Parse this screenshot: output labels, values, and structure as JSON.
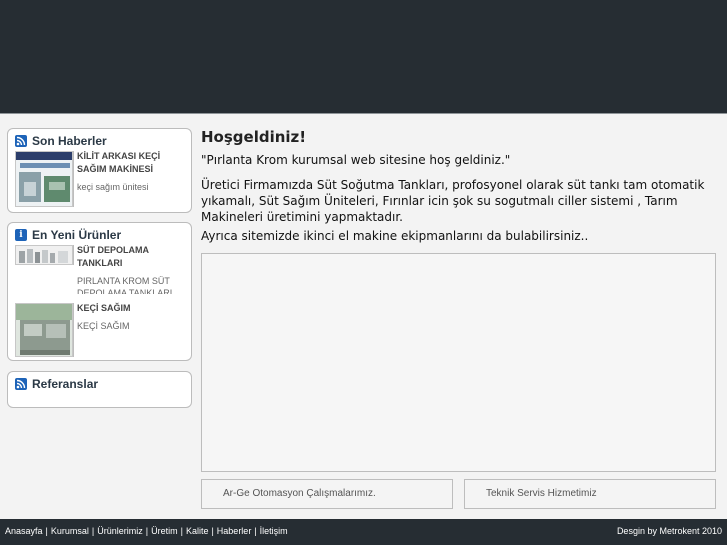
{
  "sidebar": {
    "news": {
      "title": "Son Haberler",
      "icon": "rss-icon",
      "items": [
        {
          "title": "KİLİT ARKASI KEÇİ SAĞIM MAKİNESİ",
          "subtitle": "keçi sağım ünitesi"
        }
      ]
    },
    "products": {
      "title": "En Yeni Ürünler",
      "icon": "info-icon",
      "items": [
        {
          "title": "SÜT DEPOLAMA TANKLARI",
          "subtitle": "PIRLANTA KROM SÜT DEPOLAMA TANKLARI"
        },
        {
          "title": "KEÇİ SAĞIM",
          "subtitle": "KEÇİ SAĞIM"
        }
      ]
    },
    "references": {
      "title": "Referanslar",
      "icon": "rss-icon"
    }
  },
  "main": {
    "title": "Hoşgeldiniz!",
    "paragraphs": [
      "\"Pırlanta Krom kurumsal web sitesine hoş  geldiniz.\"",
      "Üretici Firmamızda Süt Soğutma Tankları,   profosyonel   olarak süt tankı tam otomatik yıkamalı,  Süt Sağım Üniteleri, Fırınlar  icin  şok su  sogutmalı  ciller  sistemi , Tarım Makineleri üretimini yapmaktadır.",
      "Ayrıca sitemizde ikinci el makine  ekipmanlarını da bulabilirsiniz.."
    ],
    "panels": [
      "Ar-Ge Otomasyon Çalışmalarımız.",
      "Teknik Servis Hizmetimiz"
    ]
  },
  "footer": {
    "nav": [
      "Anasayfa",
      "Kurumsal",
      "Ürünlerimiz",
      "Üretim",
      "Kalite",
      "Haberler",
      "İletişim"
    ],
    "separator": "|",
    "credit": "Desgin by Metrokent 2010"
  },
  "colors": {
    "header_bg": "#262d33",
    "footer_bg": "#262d33",
    "page_bg": "#f3f3f3",
    "icon_blue": "#1d63b8"
  }
}
